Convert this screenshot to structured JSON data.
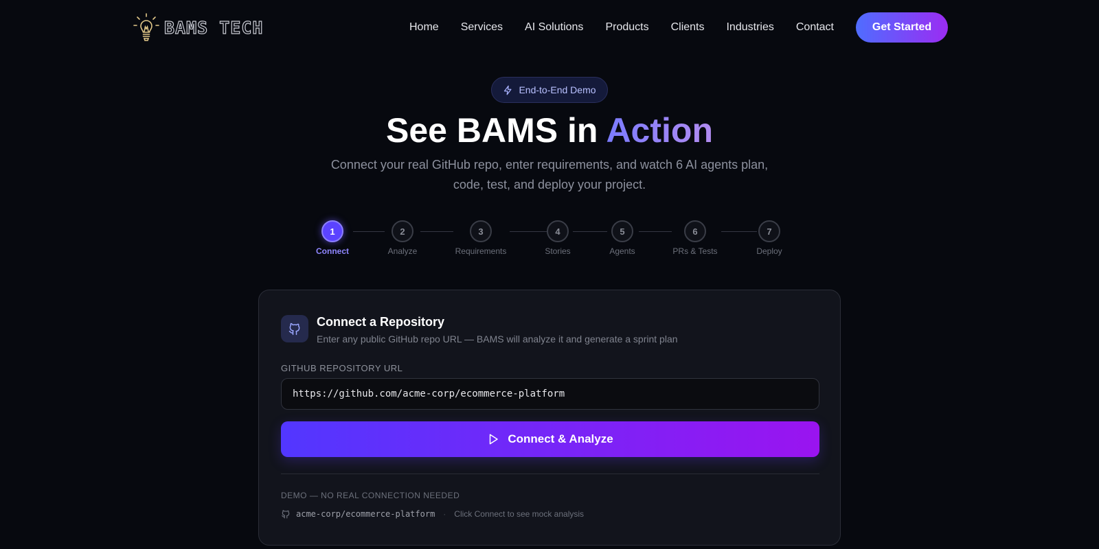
{
  "brand": {
    "name": "BAMS TECH"
  },
  "nav": {
    "links": [
      "Home",
      "Services",
      "AI Solutions",
      "Products",
      "Clients",
      "Industries",
      "Contact"
    ],
    "cta": "Get Started"
  },
  "hero": {
    "badge": "End-to-End Demo",
    "title_main": "See BAMS in ",
    "title_accent": "Action",
    "subtitle": "Connect your real GitHub repo, enter requirements, and watch 6 AI agents plan, code, test, and deploy your project."
  },
  "steps": [
    {
      "num": "1",
      "label": "Connect"
    },
    {
      "num": "2",
      "label": "Analyze"
    },
    {
      "num": "3",
      "label": "Requirements"
    },
    {
      "num": "4",
      "label": "Stories"
    },
    {
      "num": "5",
      "label": "Agents"
    },
    {
      "num": "6",
      "label": "PRs & Tests"
    },
    {
      "num": "7",
      "label": "Deploy"
    }
  ],
  "active_step": 1,
  "card": {
    "title": "Connect a Repository",
    "subtitle": "Enter any public GitHub repo URL — BAMS will analyze it and generate a sprint plan",
    "field_label": "GITHUB REPOSITORY URL",
    "url_value": "https://github.com/acme-corp/ecommerce-platform",
    "button_label": "Connect & Analyze",
    "demo_label": "DEMO — NO REAL CONNECTION NEEDED",
    "demo_repo": "acme-corp/ecommerce-platform",
    "demo_hint": "Click Connect to see mock analysis"
  },
  "colors": {
    "background": "#07090f",
    "accent": "#5b43ff",
    "accent_gradient_end": "#9a14f0"
  }
}
